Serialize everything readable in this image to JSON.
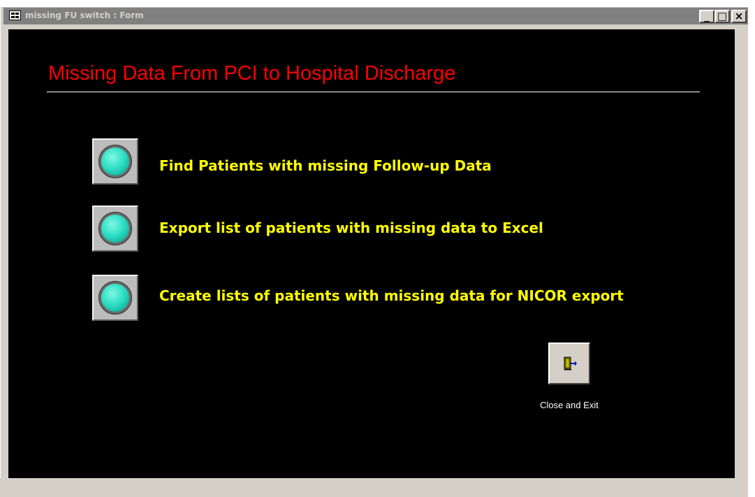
{
  "window": {
    "title": "missing FU switch : Form",
    "controls": {
      "minimize": "_",
      "maximize": "□",
      "close": "×"
    }
  },
  "form": {
    "heading": "Missing Data From PCI to Hospital Discharge",
    "heading_color": "#ff0000",
    "background_color": "#000000",
    "label_color": "#ffff00",
    "actions": [
      {
        "label": "Find Patients with missing Follow-up Data",
        "icon": "teal-round-button-icon"
      },
      {
        "label": "Export list of patients with missing data to Excel",
        "icon": "teal-round-button-icon"
      },
      {
        "label": "Create lists of patients with missing data for NICOR export",
        "icon": "teal-round-button-icon"
      }
    ],
    "exit": {
      "label": "Close and Exit",
      "icon": "exit-door-icon"
    }
  }
}
